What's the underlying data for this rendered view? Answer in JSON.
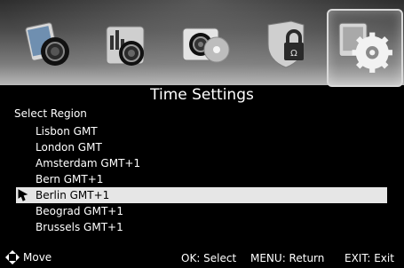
{
  "screen_title": "Time Settings",
  "region_header": "Select Region",
  "menu_icons": [
    {
      "name": "picture-settings-icon",
      "selected": false
    },
    {
      "name": "channel-equalizer-icon",
      "selected": false
    },
    {
      "name": "media-disc-icon",
      "selected": false
    },
    {
      "name": "lock-shield-icon",
      "selected": false
    },
    {
      "name": "system-gear-icon",
      "selected": true
    }
  ],
  "regions": [
    "Lisbon GMT",
    "London GMT",
    "Amsterdam GMT+1",
    "Bern GMT+1",
    "Berlin GMT+1",
    "Beograd GMT+1",
    "Brussels GMT+1"
  ],
  "selected_region": "Berlin GMT+1",
  "footer": {
    "move": "Move",
    "ok": "OK: Select",
    "menu": "MENU: Return",
    "exit": "EXIT: Exit"
  },
  "colors": {
    "background": "#000000",
    "highlight": "#e6e6e6",
    "text": "#ffffff"
  }
}
